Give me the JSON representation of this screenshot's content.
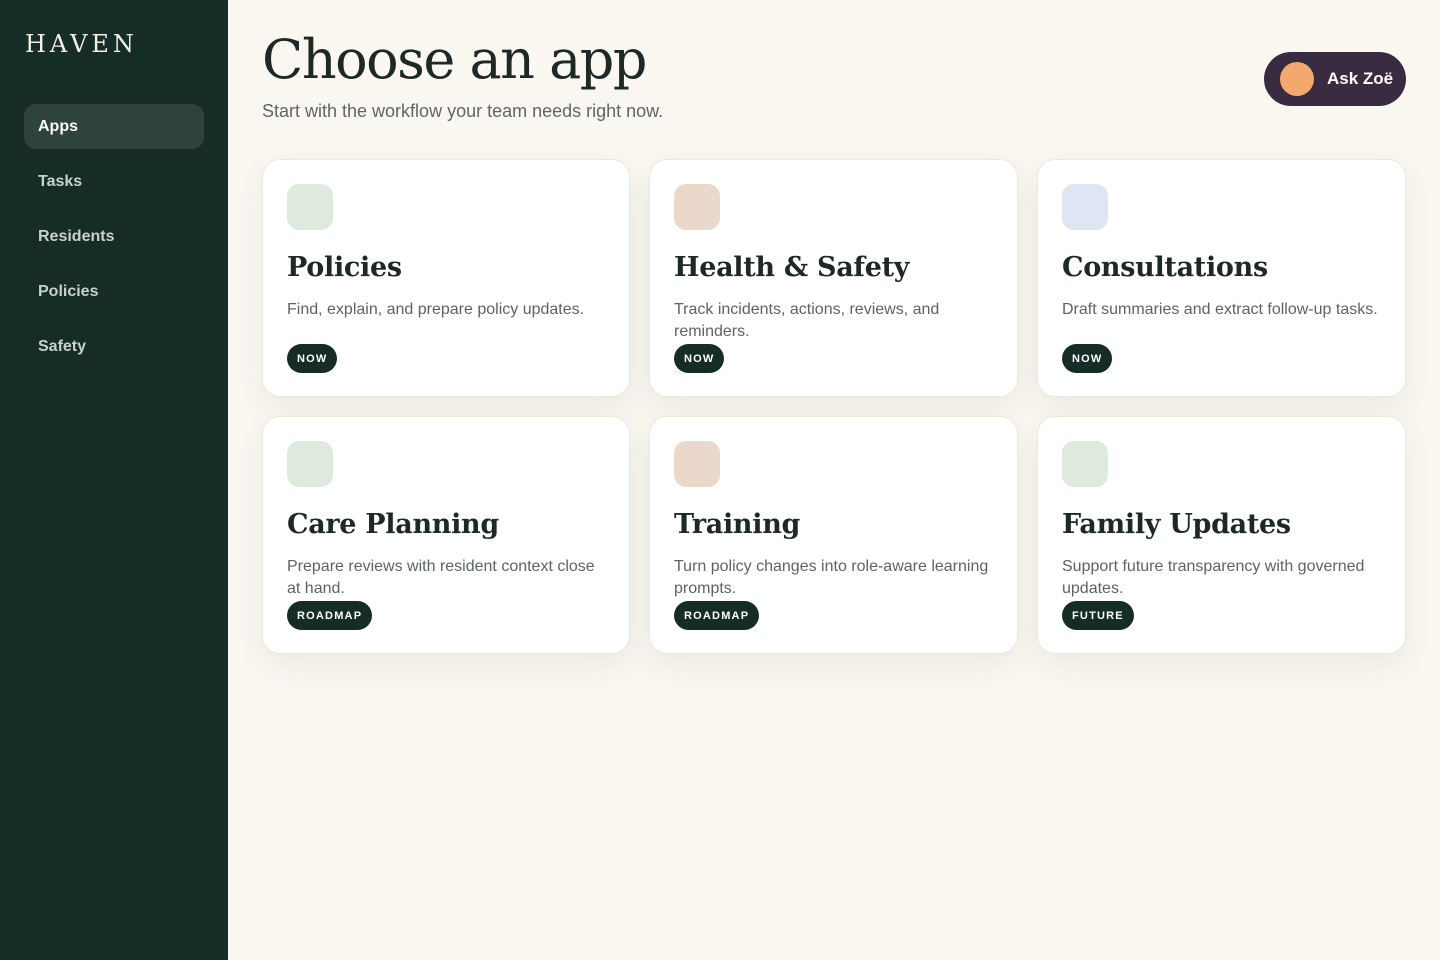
{
  "sidebar": {
    "logo": "HAVEN",
    "items": [
      {
        "label": "Apps",
        "active": true
      },
      {
        "label": "Tasks",
        "active": false
      },
      {
        "label": "Residents",
        "active": false
      },
      {
        "label": "Policies",
        "active": false
      },
      {
        "label": "Safety",
        "active": false
      }
    ]
  },
  "header": {
    "title": "Choose an app",
    "subtitle": "Start with the workflow your team needs right now.",
    "ask_button": {
      "label": "Ask Zoë",
      "avatar_color": "#f3a96d"
    }
  },
  "colors": {
    "sidebar_bg": "#162c26",
    "page_bg": "#faf7f1",
    "badge_bg": "#162c26",
    "ask_bg": "#392b40"
  },
  "cards": [
    {
      "title": "Policies",
      "description": "Find, explain, and prepare policy updates.",
      "badge": "NOW",
      "icon_color": "#dfeadf"
    },
    {
      "title": "Health & Safety",
      "description": "Track incidents, actions, reviews, and reminders.",
      "badge": "NOW",
      "icon_color": "#ead8ca"
    },
    {
      "title": "Consultations",
      "description": "Draft summaries and extract follow-up tasks.",
      "badge": "NOW",
      "icon_color": "#dfe5f3"
    },
    {
      "title": "Care Planning",
      "description": "Prepare reviews with resident context close at hand.",
      "badge": "ROADMAP",
      "icon_color": "#dfeadf"
    },
    {
      "title": "Training",
      "description": "Turn policy changes into role-aware learning prompts.",
      "badge": "ROADMAP",
      "icon_color": "#ead8ca"
    },
    {
      "title": "Family Updates",
      "description": "Support future transparency with governed updates.",
      "badge": "FUTURE",
      "icon_color": "#dfeadf"
    }
  ]
}
